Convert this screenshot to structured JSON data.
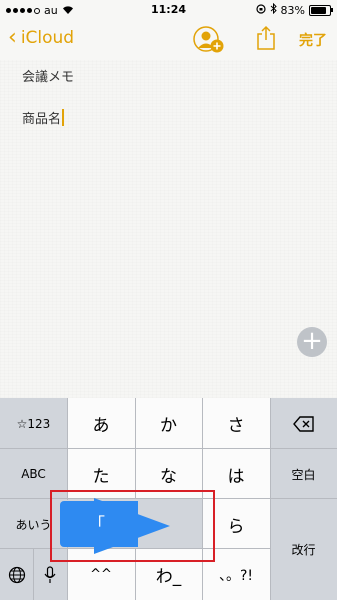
{
  "status_bar": {
    "carrier": "au",
    "time": "11:24",
    "battery": "83%"
  },
  "nav": {
    "back_label": "iCloud",
    "done_label": "完了"
  },
  "note": {
    "line1": "会議メモ",
    "line2": "商品名"
  },
  "keyboard": {
    "row1": [
      "☆123",
      "あ",
      "か",
      "さ"
    ],
    "row2": [
      "ABC",
      "た",
      "な",
      "は",
      "空白"
    ],
    "row3": [
      "あいう",
      "ら",
      "改行"
    ],
    "row4": [
      "^^",
      "わ_",
      "、。?!"
    ],
    "popup_char": "「"
  }
}
